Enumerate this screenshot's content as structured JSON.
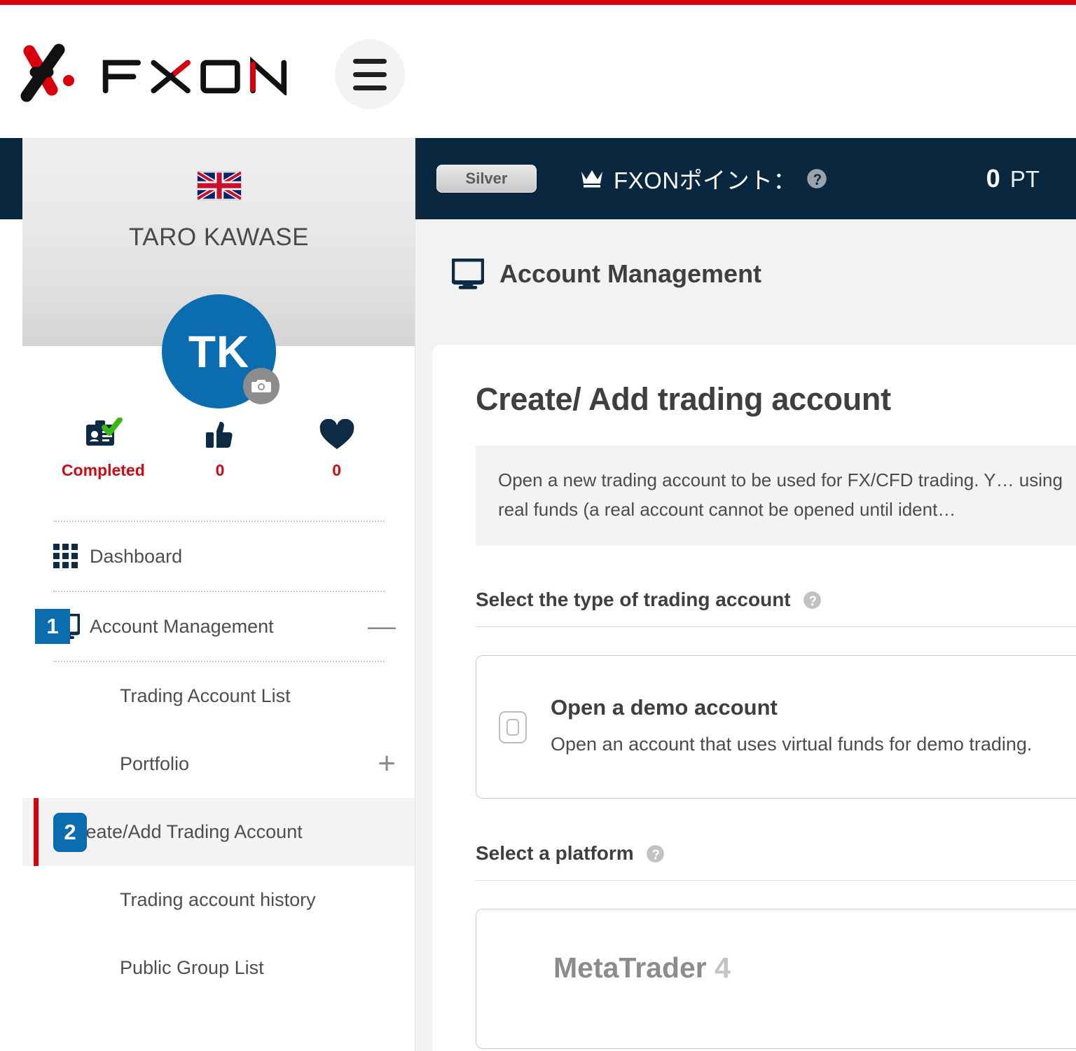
{
  "brand": {
    "logo_name": "FXON",
    "menu_icon": "hamburger-menu-icon"
  },
  "topbar": {
    "tier_label": "Silver",
    "crown_icon": "crown-icon",
    "points_label": "FXONポイント：",
    "points_help_icon": "help-circle-icon",
    "points_value": "0",
    "points_unit": "PT"
  },
  "sidebar": {
    "flag_icon": "uk-flag-icon",
    "user_name": "TARO KAWASE",
    "avatar_initials": "TK",
    "avatar_camera_icon": "camera-icon",
    "stats": [
      {
        "icon": "id-card-verified-icon",
        "label": "Completed"
      },
      {
        "icon": "thumbs-up-icon",
        "label": "0"
      },
      {
        "icon": "heart-icon",
        "label": "0"
      }
    ],
    "nav": [
      {
        "icon": "grid-icon",
        "label": "Dashboard",
        "tool": "",
        "badge": ""
      },
      {
        "icon": "monitor-icon",
        "label": "Account Management",
        "tool": "—",
        "badge": "1"
      }
    ],
    "sub_items": [
      {
        "label": "Trading Account List",
        "tool": "",
        "badge": "",
        "active": false
      },
      {
        "label": "Portfolio",
        "tool": "+",
        "badge": "",
        "active": false
      },
      {
        "label": "Create/Add Trading Account",
        "tool": "",
        "badge": "2",
        "active": true
      },
      {
        "label": "Trading account history",
        "tool": "",
        "badge": "",
        "active": false
      },
      {
        "label": "Public Group List",
        "tool": "",
        "badge": "",
        "active": false
      }
    ]
  },
  "main": {
    "page_icon": "monitor-icon",
    "page_title": "Account Management",
    "card_heading": "Create/ Add trading account",
    "notice_text": "Open a new trading account to be used for FX/CFD trading. Y… using real funds (a real account cannot be opened until ident…",
    "section_account_type": {
      "title": "Select the type of trading account",
      "help_icon": "help-circle-icon",
      "options": [
        {
          "checkbox": "unchecked-toggle",
          "title": "Open a demo account",
          "desc": "Open an account that uses virtual funds for demo trading."
        }
      ]
    },
    "section_platform": {
      "title": "Select a platform",
      "help_icon": "help-circle-icon",
      "platforms": [
        {
          "name": "MetaTrader",
          "version": "4"
        }
      ]
    }
  },
  "colors": {
    "accent_red": "#d9000d",
    "navy": "#0a2740",
    "brand_blue": "#0c6cb0",
    "stat_red": "#cf0a18"
  }
}
